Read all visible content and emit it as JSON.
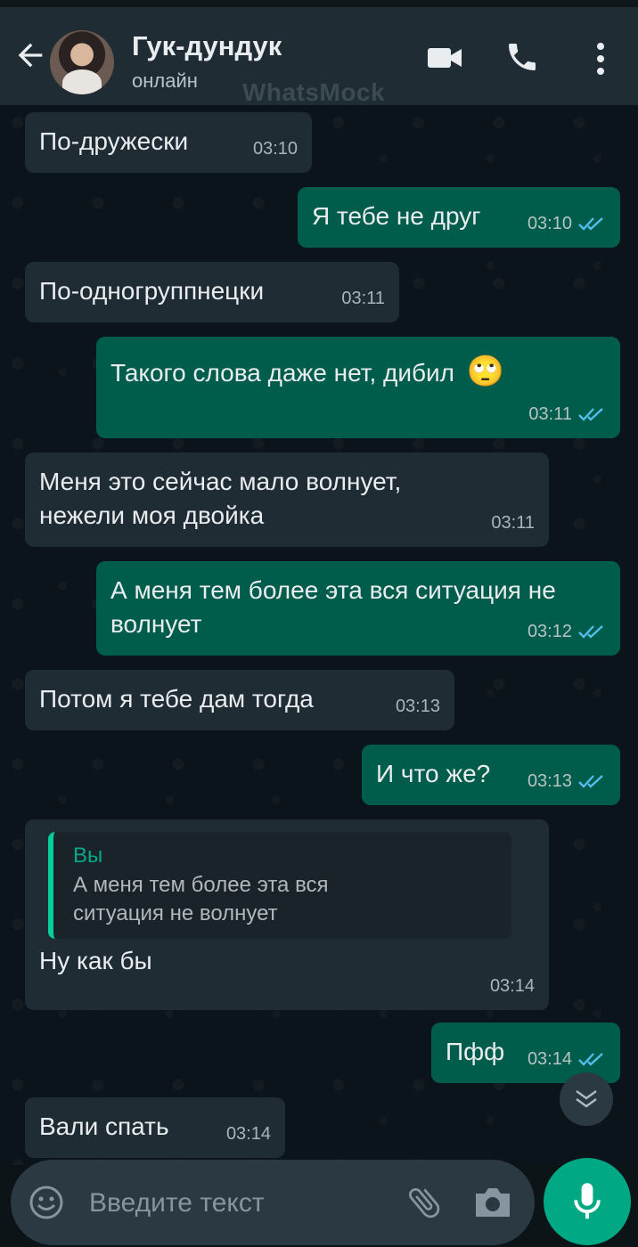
{
  "header": {
    "contact_name": "Гук-дундук",
    "status": "онлайн",
    "watermark": "WhatsMock"
  },
  "messages": [
    {
      "dir": "in",
      "text": "По-дружески",
      "time": "03:10"
    },
    {
      "dir": "out",
      "text": "Я тебе не друг",
      "time": "03:10",
      "read": true
    },
    {
      "dir": "in",
      "text": "По-одногруппнецки",
      "time": "03:11"
    },
    {
      "dir": "out",
      "text": "Такого слова даже нет, дибил",
      "emoji": "🙄",
      "time": "03:11",
      "read": true
    },
    {
      "dir": "in",
      "text": "Меня это сейчас мало волнует, нежели моя двойка",
      "time": "03:11"
    },
    {
      "dir": "out",
      "text": "А меня тем более эта вся ситуация не волнует",
      "time": "03:12",
      "read": true
    },
    {
      "dir": "in",
      "text": "Потом я тебе дам тогда",
      "time": "03:13"
    },
    {
      "dir": "out",
      "text": "И что же?",
      "time": "03:13",
      "read": true
    },
    {
      "dir": "in",
      "quote_author": "Вы",
      "quote_text": "А меня тем более эта вся ситуация не волнует",
      "text": "Ну как бы",
      "time": "03:14"
    },
    {
      "dir": "out",
      "text": "Пфф",
      "time": "03:14",
      "read": true
    },
    {
      "dir": "in",
      "text": "Вали спать",
      "time": "03:14"
    }
  ],
  "input": {
    "placeholder": "Введите текст"
  },
  "colors": {
    "header_bg": "#1f2c34",
    "incoming_bg": "#1f2c34",
    "outgoing_bg": "#005c4b",
    "read_tick": "#53bdeb",
    "accent": "#00a884"
  },
  "icons": [
    "back-arrow-icon",
    "video-call-icon",
    "phone-icon",
    "more-vert-icon",
    "emoji-icon",
    "attach-icon",
    "camera-icon",
    "mic-icon",
    "chevron-down-icon",
    "read-check-icon"
  ]
}
